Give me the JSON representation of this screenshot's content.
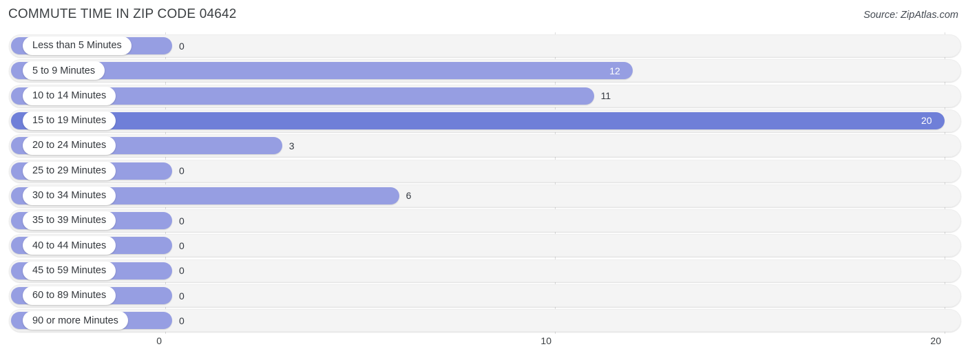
{
  "header": {
    "title": "COMMUTE TIME IN ZIP CODE 04642",
    "source": "Source: ZipAtlas.com"
  },
  "colors": {
    "bar": "#969ee2",
    "bar_max": "#6f7fd8",
    "track": "#f4f4f4",
    "gridline": "#dcdcdc",
    "title": "#3c4043"
  },
  "chart_data": {
    "type": "bar",
    "orientation": "horizontal",
    "title": "COMMUTE TIME IN ZIP CODE 04642",
    "xlabel": "",
    "ylabel": "",
    "xlim": [
      0,
      20
    ],
    "grid": true,
    "legend": null,
    "xticks": [
      "0",
      "10",
      "20"
    ],
    "xtick_values": [
      0,
      10,
      20
    ],
    "categories": [
      "Less than 5 Minutes",
      "5 to 9 Minutes",
      "10 to 14 Minutes",
      "15 to 19 Minutes",
      "20 to 24 Minutes",
      "25 to 29 Minutes",
      "30 to 34 Minutes",
      "35 to 39 Minutes",
      "40 to 44 Minutes",
      "45 to 59 Minutes",
      "60 to 89 Minutes",
      "90 or more Minutes"
    ],
    "values": [
      0,
      12,
      11,
      20,
      3,
      0,
      6,
      0,
      0,
      0,
      0,
      0
    ],
    "value_labels": [
      "0",
      "12",
      "11",
      "20",
      "3",
      "0",
      "6",
      "0",
      "0",
      "0",
      "0",
      "0"
    ],
    "label_placement": [
      "outside",
      "inside",
      "outside",
      "inside",
      "outside",
      "outside",
      "outside",
      "outside",
      "outside",
      "outside",
      "outside",
      "outside"
    ]
  }
}
